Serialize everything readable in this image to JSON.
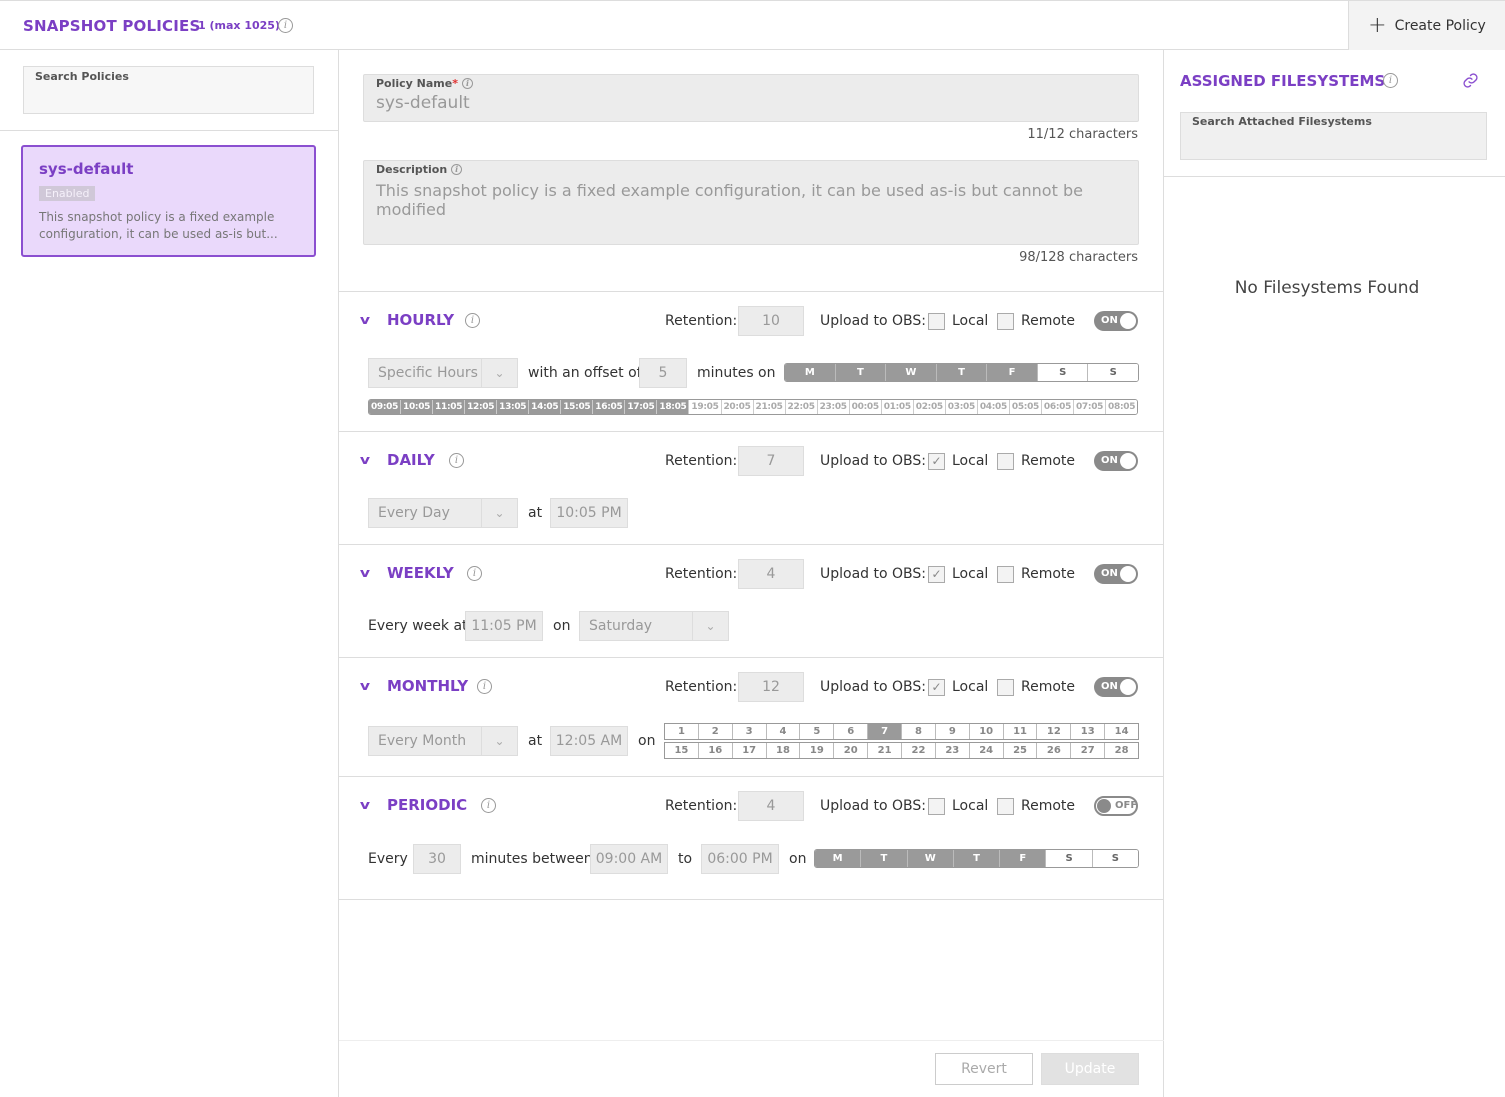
{
  "header": {
    "title": "SNAPSHOT POLICIES",
    "count": "1 (max 1025)",
    "create_label": "Create Policy"
  },
  "left": {
    "search_label": "Search Policies",
    "policy": {
      "name": "sys-default",
      "status": "Enabled",
      "description": "This snapshot policy is a fixed example configuration, it can be used as-is but..."
    }
  },
  "form": {
    "name_label": "Policy Name",
    "name_value": "sys-default",
    "name_count": "11/12 characters",
    "desc_label": "Description",
    "desc_value": "This snapshot policy is a fixed example configuration, it can be used as-is but cannot be modified",
    "desc_count": "98/128 characters"
  },
  "common": {
    "retention_label": "Retention:",
    "obs_label": "Upload to OBS:",
    "local_label": "Local",
    "remote_label": "Remote",
    "on": "ON",
    "off": "OFF",
    "at": "at",
    "on_word": "on"
  },
  "hourly": {
    "title": "HOURLY",
    "retention": "10",
    "local_checked": false,
    "mode": "Specific Hours",
    "offset_label": "with an offset of",
    "offset": "5",
    "minutes_label": "minutes",
    "days": [
      {
        "l": "M",
        "s": true
      },
      {
        "l": "T",
        "s": true
      },
      {
        "l": "W",
        "s": true
      },
      {
        "l": "T",
        "s": true
      },
      {
        "l": "F",
        "s": true
      },
      {
        "l": "S",
        "s": false
      },
      {
        "l": "S",
        "s": false
      }
    ],
    "hours": [
      {
        "l": "09:05",
        "s": true
      },
      {
        "l": "10:05",
        "s": true
      },
      {
        "l": "11:05",
        "s": true
      },
      {
        "l": "12:05",
        "s": true
      },
      {
        "l": "13:05",
        "s": true
      },
      {
        "l": "14:05",
        "s": true
      },
      {
        "l": "15:05",
        "s": true
      },
      {
        "l": "16:05",
        "s": true
      },
      {
        "l": "17:05",
        "s": true
      },
      {
        "l": "18:05",
        "s": true
      },
      {
        "l": "19:05",
        "s": false
      },
      {
        "l": "20:05",
        "s": false
      },
      {
        "l": "21:05",
        "s": false
      },
      {
        "l": "22:05",
        "s": false
      },
      {
        "l": "23:05",
        "s": false
      },
      {
        "l": "00:05",
        "s": false
      },
      {
        "l": "01:05",
        "s": false
      },
      {
        "l": "02:05",
        "s": false
      },
      {
        "l": "03:05",
        "s": false
      },
      {
        "l": "04:05",
        "s": false
      },
      {
        "l": "05:05",
        "s": false
      },
      {
        "l": "06:05",
        "s": false
      },
      {
        "l": "07:05",
        "s": false
      },
      {
        "l": "08:05",
        "s": false
      }
    ]
  },
  "daily": {
    "title": "DAILY",
    "retention": "7",
    "local_checked": true,
    "mode": "Every Day",
    "time": "10:05 PM"
  },
  "weekly": {
    "title": "WEEKLY",
    "retention": "4",
    "local_checked": true,
    "prefix": "Every week at",
    "time": "11:05 PM",
    "day": "Saturday"
  },
  "monthly": {
    "title": "MONTHLY",
    "retention": "12",
    "local_checked": true,
    "mode": "Every Month",
    "time": "12:05 AM",
    "selected_day": 7
  },
  "periodic": {
    "title": "PERIODIC",
    "retention": "4",
    "local_checked": false,
    "every": "Every",
    "interval": "30",
    "between_label": "minutes between",
    "start": "09:00 AM",
    "to": "to",
    "end": "06:00 PM",
    "days": [
      {
        "l": "M",
        "s": true
      },
      {
        "l": "T",
        "s": true
      },
      {
        "l": "W",
        "s": true
      },
      {
        "l": "T",
        "s": true
      },
      {
        "l": "F",
        "s": true
      },
      {
        "l": "S",
        "s": false
      },
      {
        "l": "S",
        "s": false
      }
    ]
  },
  "footer": {
    "revert": "Revert",
    "update": "Update"
  },
  "right": {
    "title": "ASSIGNED FILESYSTEMS",
    "search_label": "Search Attached Filesystems",
    "empty": "No Filesystems Found"
  }
}
